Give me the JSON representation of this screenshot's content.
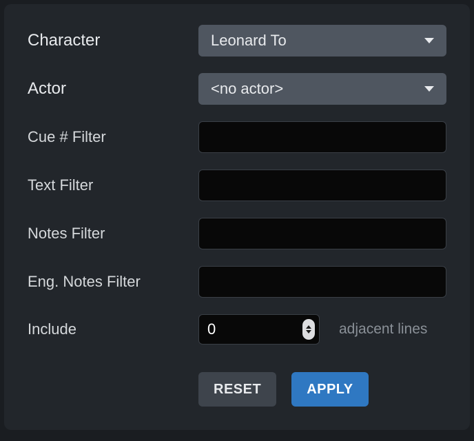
{
  "fields": {
    "character": {
      "label": "Character",
      "value": "Leonard To"
    },
    "actor": {
      "label": "Actor",
      "value": "<no actor>"
    },
    "cueFilter": {
      "label": "Cue # Filter",
      "value": ""
    },
    "textFilter": {
      "label": "Text Filter",
      "value": ""
    },
    "notesFilter": {
      "label": "Notes Filter",
      "value": ""
    },
    "engNotesFilter": {
      "label": "Eng. Notes Filter",
      "value": ""
    },
    "include": {
      "label": "Include",
      "value": "0",
      "suffix": "adjacent lines"
    }
  },
  "buttons": {
    "reset": "RESET",
    "apply": "APPLY"
  }
}
